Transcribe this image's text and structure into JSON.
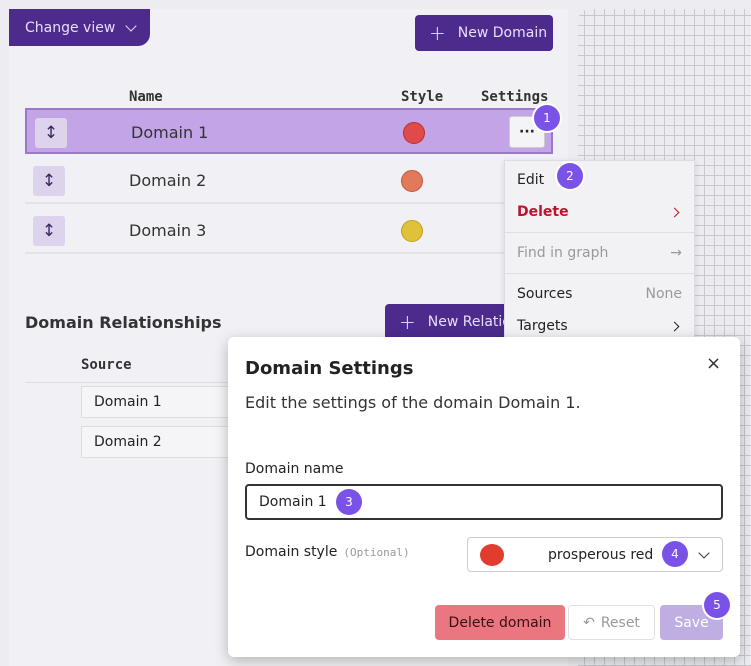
{
  "colors": {
    "primary": "#4c2b8d",
    "selected_row": "#c3a4e6",
    "badge": "#7a52e8",
    "delete": "#ea7680",
    "danger_text": "#c0102a"
  },
  "toolbar": {
    "change_view": "Change view",
    "new_domain": "New Domain"
  },
  "table": {
    "headers": {
      "name": "Name",
      "style": "Style",
      "settings": "Settings"
    },
    "rows": [
      {
        "name": "Domain 1",
        "color": "#e04a4a",
        "selected": true
      },
      {
        "name": "Domain 2",
        "color": "#e07a5a"
      },
      {
        "name": "Domain 3",
        "color": "#e0c23a"
      }
    ],
    "settings_button": "···"
  },
  "relationships": {
    "title": "Domain Relationships",
    "new_button": "New Relatio",
    "source_header": "Source",
    "sources": [
      "Domain 1",
      "Domain 2"
    ]
  },
  "menu": {
    "edit": "Edit",
    "delete": "Delete",
    "find_in_graph": "Find in graph",
    "sources": "Sources",
    "sources_value": "None",
    "targets": "Targets"
  },
  "dialog": {
    "title": "Domain Settings",
    "description": "Edit the settings of the domain Domain 1.",
    "name_label": "Domain name",
    "name_value": "Domain 1",
    "style_label": "Domain style",
    "style_optional": "(Optional)",
    "style_value": "prosperous red",
    "style_color": "#e23c2f",
    "delete_button": "Delete domain",
    "reset_button": "Reset",
    "save_button": "Save",
    "close": "×"
  },
  "badges": [
    "1",
    "2",
    "3",
    "4",
    "5"
  ]
}
